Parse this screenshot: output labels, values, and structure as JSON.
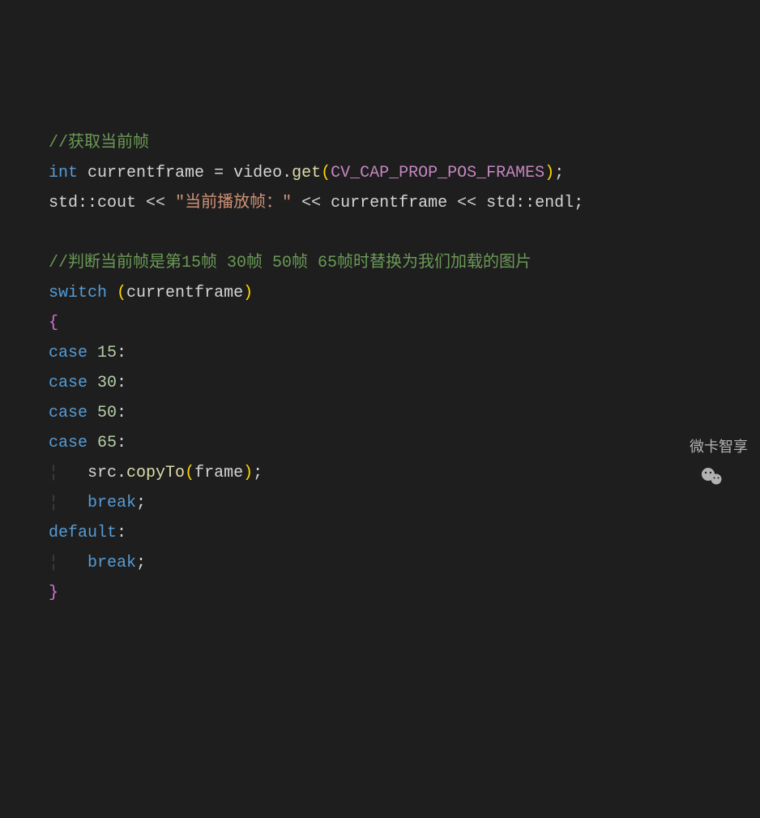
{
  "code": {
    "line1_comment": "//获取当前帧",
    "line2_type": "int",
    "line2_var": "currentframe",
    "line2_eq": " = ",
    "line2_obj": "video",
    "line2_dot": ".",
    "line2_fn": "get",
    "line2_lparen": "(",
    "line2_arg": "CV_CAP_PROP_POS_FRAMES",
    "line2_rparen": ")",
    "line2_semi": ";",
    "line3_std": "std",
    "line3_scope": "::",
    "line3_cout": "cout",
    "line3_op1": " << ",
    "line3_str": "\"当前播放帧：\"",
    "line3_op2": " << ",
    "line3_var": "currentframe",
    "line3_op3": " << ",
    "line3_std2": "std",
    "line3_scope2": "::",
    "line3_endl": "endl",
    "line3_semi": ";",
    "line5_comment": "//判断当前帧是第15帧 30帧 50帧 65帧时替换为我们加载的图片",
    "line6_switch": "switch",
    "line6_sp": " ",
    "line6_lparen": "(",
    "line6_var": "currentframe",
    "line6_rparen": ")",
    "line7_brace": "{",
    "line8_case": "case",
    "line8_sp": " ",
    "line8_num": "15",
    "line8_colon": ":",
    "line9_case": "case",
    "line9_sp": " ",
    "line9_num": "30",
    "line9_colon": ":",
    "line10_case": "case",
    "line10_sp": " ",
    "line10_num": "50",
    "line10_colon": ":",
    "line11_case": "case",
    "line11_sp": " ",
    "line11_num": "65",
    "line11_colon": ":",
    "line12_obj": "src",
    "line12_dot": ".",
    "line12_fn": "copyTo",
    "line12_lparen": "(",
    "line12_arg": "frame",
    "line12_rparen": ")",
    "line12_semi": ";",
    "line13_break": "break",
    "line13_semi": ";",
    "line14_default": "default",
    "line14_colon": ":",
    "line15_break": "break",
    "line15_semi": ";",
    "line16_brace": "}"
  },
  "watermark": {
    "text": "微卡智享"
  }
}
